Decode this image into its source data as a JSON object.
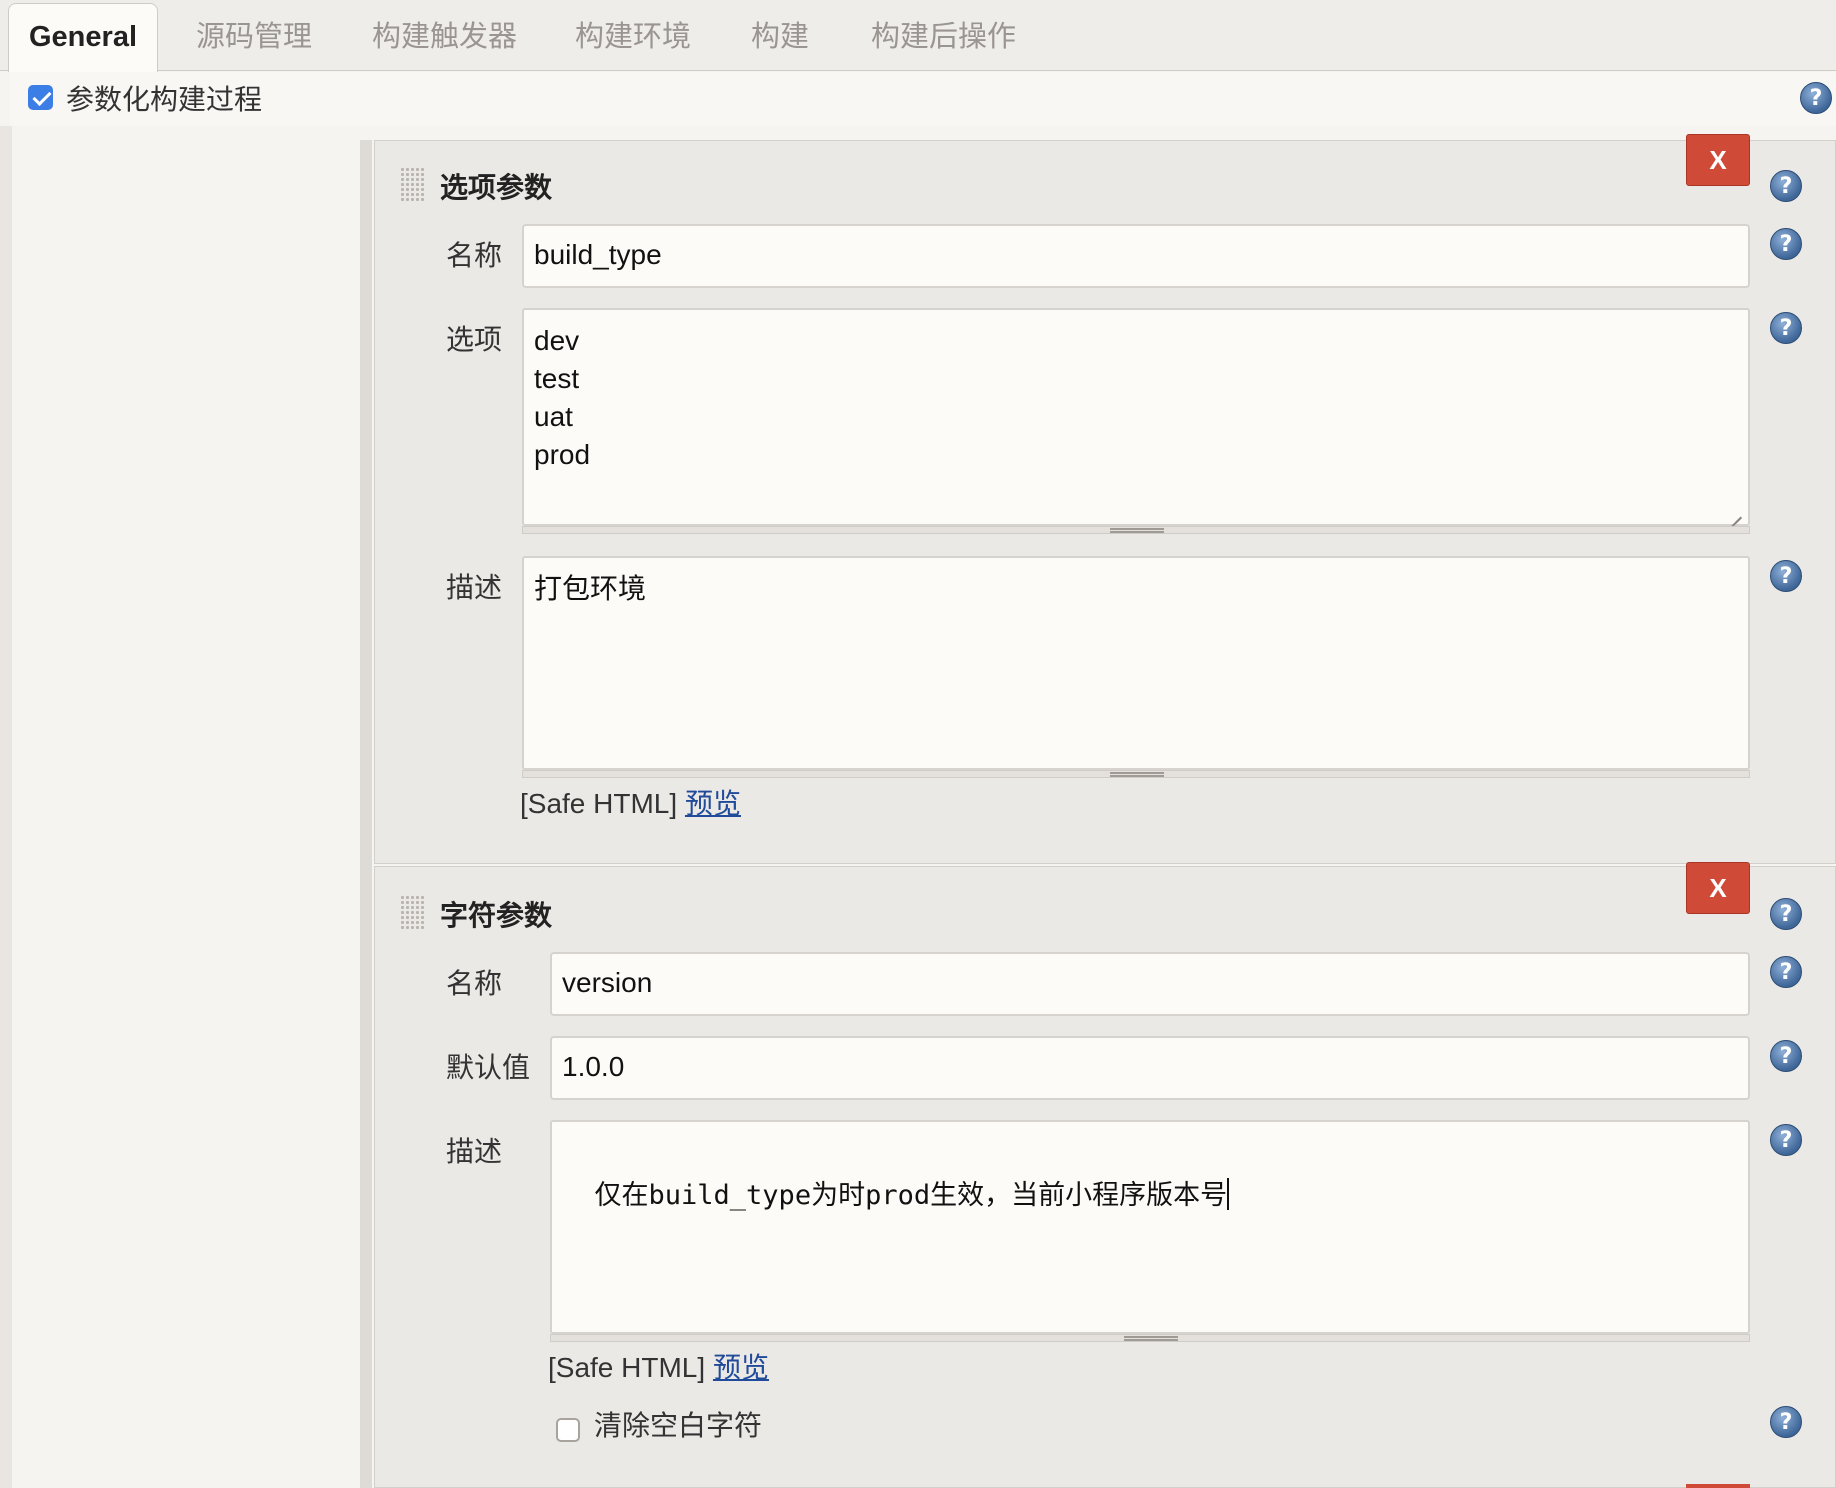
{
  "tabs": [
    {
      "label": "General",
      "active": true
    },
    {
      "label": "源码管理"
    },
    {
      "label": "构建触发器"
    },
    {
      "label": "构建环境"
    },
    {
      "label": "构建"
    },
    {
      "label": "构建后操作"
    }
  ],
  "param_build": {
    "label": "参数化构建过程",
    "checked": true
  },
  "help_glyph": "?",
  "choice_param": {
    "title": "选项参数",
    "delete_label": "X",
    "name_label": "名称",
    "name_value": "build_type",
    "choices_label": "选项",
    "choices_value": "dev\ntest\nuat\nprod",
    "desc_label": "描述",
    "desc_value": "打包环境",
    "safe_html": "[Safe HTML]",
    "preview": "预览"
  },
  "string_param": {
    "title": "字符参数",
    "delete_label": "X",
    "name_label": "名称",
    "name_value": "version",
    "default_label": "默认值",
    "default_value": "1.0.0",
    "desc_label": "描述",
    "desc_value": "仅在build_type为时prod生效，当前小程序版本号",
    "safe_html": "[Safe HTML]",
    "preview": "预览",
    "trim_label": "清除空白字符",
    "trim_checked": false
  },
  "colors": {
    "accent": "#3b7ee6",
    "danger": "#cf4b38",
    "link": "#204a9a"
  }
}
